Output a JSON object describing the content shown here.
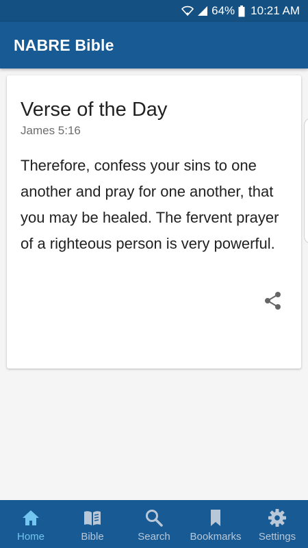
{
  "status_bar": {
    "battery": "64%",
    "time": "10:21 AM"
  },
  "app_bar": {
    "title": "NABRE Bible"
  },
  "verse_card": {
    "title": "Verse of the Day",
    "reference": "James 5:16",
    "text": "Therefore, confess your sins to one another and pray for one another, that you may be healed. The fervent prayer of a righteous person is very powerful.",
    "share_icon": "share-icon"
  },
  "bottom_nav": {
    "active": "Home",
    "items": [
      {
        "label": "Home",
        "icon": "home-icon"
      },
      {
        "label": "Bible",
        "icon": "book-icon"
      },
      {
        "label": "Search",
        "icon": "search-icon"
      },
      {
        "label": "Bookmarks",
        "icon": "bookmark-icon"
      },
      {
        "label": "Settings",
        "icon": "gear-icon"
      }
    ]
  },
  "colors": {
    "primary": "#185a93",
    "status_bar": "#155082",
    "nav_active": "#73c6ef",
    "nav_inactive": "#b9c8d8"
  }
}
